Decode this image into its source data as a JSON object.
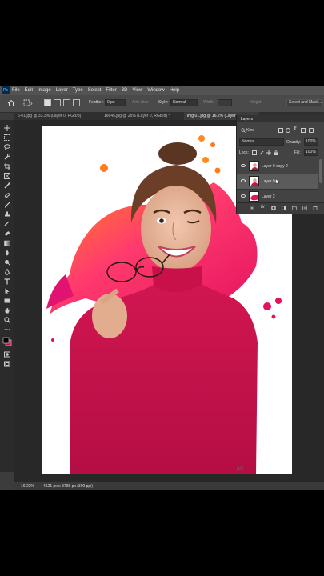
{
  "app": {
    "logo": "Ps"
  },
  "menu": [
    "File",
    "Edit",
    "Image",
    "Layer",
    "Type",
    "Select",
    "Filter",
    "3D",
    "View",
    "Window",
    "Help"
  ],
  "options": {
    "feather_label": "Feather:",
    "feather_value": "0 px",
    "antialias_label": "Anti-alias",
    "style_label": "Style:",
    "style_value": "Normal",
    "width_label": "Width:",
    "height_label": "Height:",
    "select_mask_button": "Select and Mask..."
  },
  "tabs": [
    {
      "label": "6-01.jpg @ 33.3% (Layer 0, RGB/8)",
      "active": false
    },
    {
      "label": "16645.jpg @ 25% (Layer 0, RGB/8) *",
      "active": false
    },
    {
      "label": "img 01.jpg @ 16.2% (Layer",
      "active": true
    }
  ],
  "status": {
    "zoom": "16.22%",
    "doc_info": "4121 px x 3798 px (300 ppi)"
  },
  "layers_panel": {
    "title": "Layers",
    "kind_label": "Kind",
    "blend_mode": "Normal",
    "opacity_label": "Opacity:",
    "opacity_value": "100%",
    "lock_label": "Lock:",
    "fill_label": "Fill:",
    "fill_value": "100%",
    "layers": [
      {
        "name": "Layer 0 copy 2",
        "visible": true,
        "selected": false
      },
      {
        "name": "Layer 0 c...",
        "visible": true,
        "selected": true
      },
      {
        "name": "Layer 2",
        "visible": true,
        "selected": false
      }
    ]
  },
  "colors": {
    "foreground": "#000000",
    "background": "#c8104a",
    "accent_magenta": "#e3135f",
    "accent_orange": "#ff7a1a"
  },
  "watermark": "ark"
}
